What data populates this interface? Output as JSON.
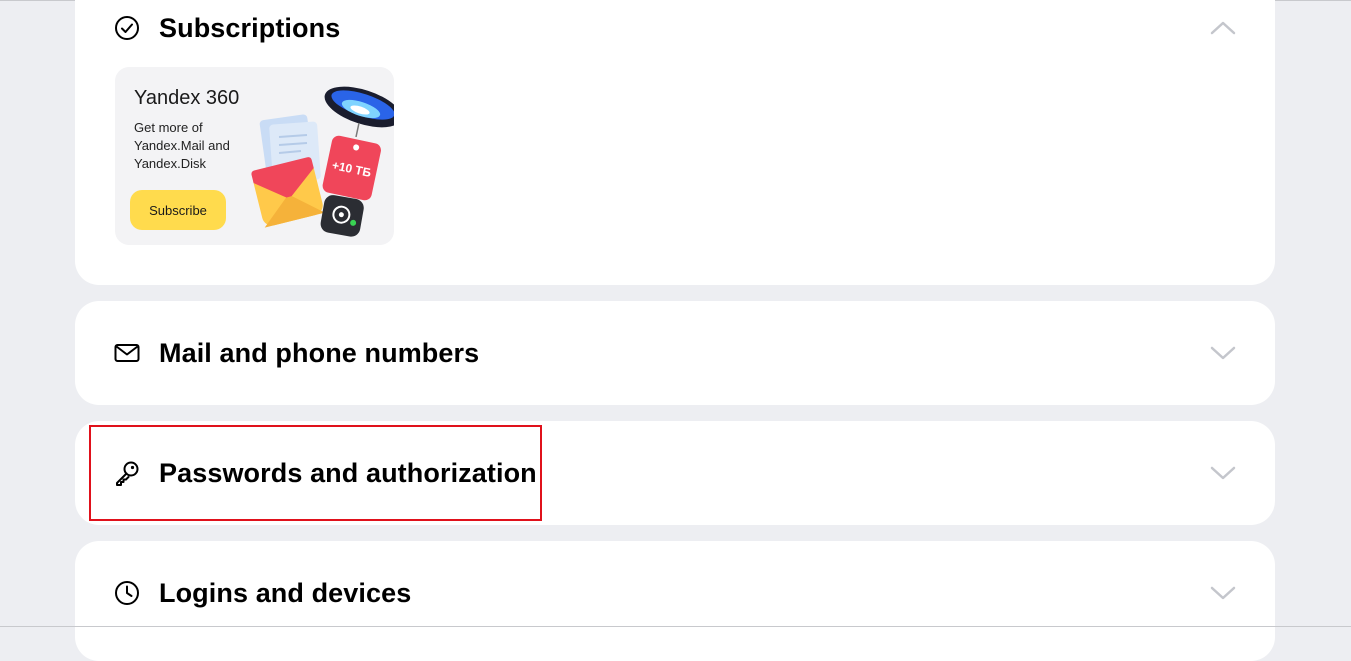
{
  "sections": {
    "subscriptions": {
      "title": "Subscriptions",
      "icon": "check-circle-icon",
      "expanded": true,
      "promo": {
        "title": "Yandex 360",
        "text": "Get more of Yandex.Mail and Yandex.Disk",
        "button_label": "Subscribe",
        "badge_text": "+10 ТБ"
      }
    },
    "mail_phone": {
      "title": "Mail and phone numbers",
      "icon": "envelope-icon",
      "expanded": false
    },
    "passwords": {
      "title": "Passwords and authorization",
      "icon": "key-icon",
      "expanded": false
    },
    "logins": {
      "title": "Logins and devices",
      "icon": "clock-icon",
      "expanded": false
    }
  },
  "colors": {
    "page_bg": "#edeef2",
    "card_bg": "#ffffff",
    "promo_bg": "#f3f3f5",
    "button_yellow": "#ffdb4d",
    "highlight_red": "#e0111b",
    "chevron_gray": "#c4c6cc"
  }
}
